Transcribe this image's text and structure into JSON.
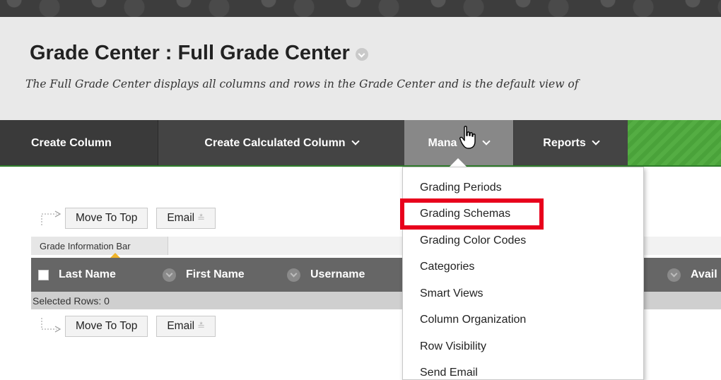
{
  "page": {
    "title": "Grade Center : Full Grade Center",
    "description": "The Full Grade Center displays all columns and rows in the Grade Center and is the default view of"
  },
  "action_bar": {
    "create_column": "Create Column",
    "create_calculated_column": "Create Calculated Column",
    "manage": "Mana",
    "reports": "Reports"
  },
  "manage_menu": {
    "items": [
      "Grading Periods",
      "Grading Schemas",
      "Grading Color Codes",
      "Categories",
      "Smart Views",
      "Column Organization",
      "Row Visibility",
      "Send Email"
    ],
    "highlighted": "Grading Schemas"
  },
  "toolbar": {
    "move_to_top": "Move To Top",
    "email": "Email"
  },
  "grade_info_bar": "Grade Information Bar",
  "table": {
    "columns": [
      "Last Name",
      "First Name",
      "Username",
      "Avail"
    ],
    "selected_rows": "Selected Rows: 0"
  },
  "colors": {
    "action_bar": "#444444",
    "manage_active": "#888888",
    "accent_green": "#4aa23a",
    "highlight_red": "#e8001c",
    "info_caret": "#f0b429"
  },
  "icons": [
    "chevron-down-icon",
    "hand-cursor-icon",
    "return-arrow-icon",
    "checkbox-icon"
  ]
}
